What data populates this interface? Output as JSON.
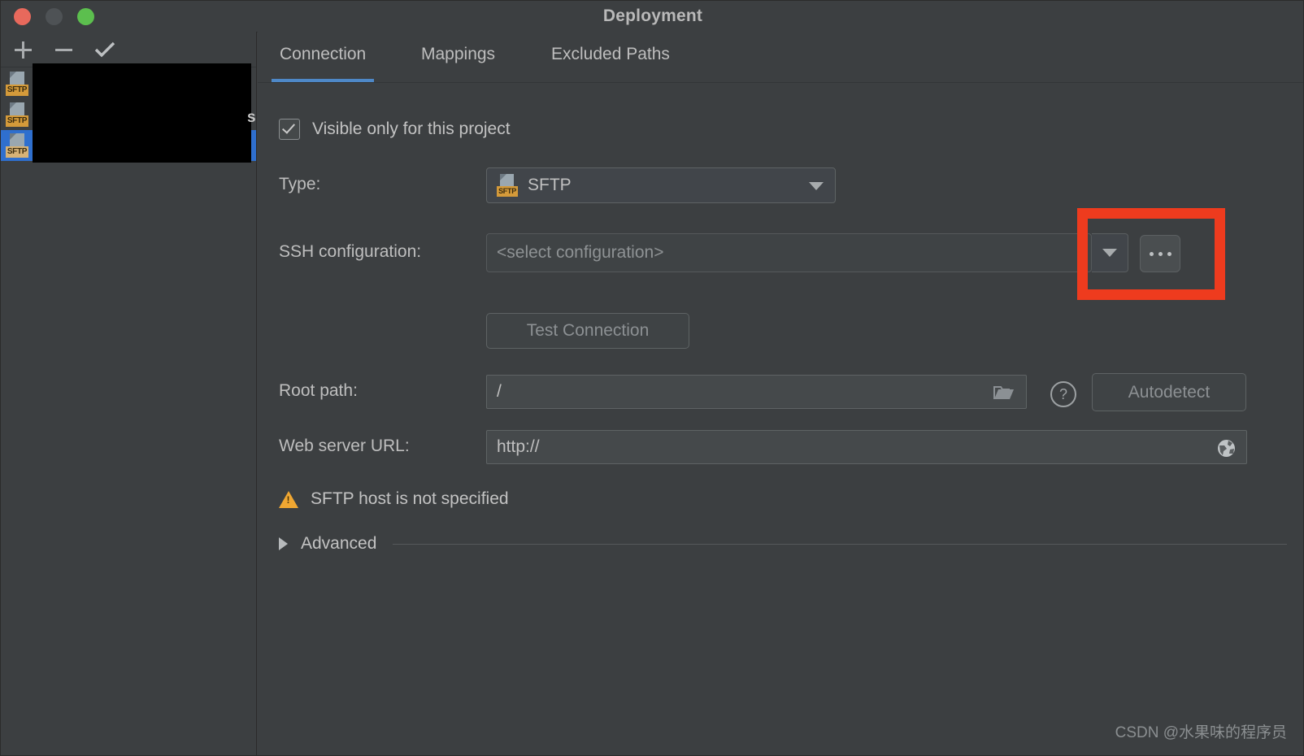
{
  "window": {
    "title": "Deployment",
    "traffic_lights": [
      "close-button",
      "minimize-button",
      "maximize-button"
    ]
  },
  "sidebar": {
    "toolbar": {
      "add_label": "+",
      "remove_label": "−",
      "confirm_label": "✓"
    },
    "items": [
      {
        "label": "",
        "type": "SFTP",
        "selected": false
      },
      {
        "label": "",
        "type": "SFTP",
        "selected": false
      },
      {
        "label": "",
        "type": "SFTP",
        "selected": true
      }
    ],
    "redacted_partial_text": "s"
  },
  "tabs": [
    {
      "label": "Connection",
      "active": true
    },
    {
      "label": "Mappings",
      "active": false
    },
    {
      "label": "Excluded Paths",
      "active": false
    }
  ],
  "connection": {
    "visible_only_checkbox": {
      "label": "Visible only for this project",
      "checked": true
    },
    "type": {
      "label": "Type:",
      "value": "SFTP",
      "icon": "sftp-icon"
    },
    "ssh_configuration": {
      "label": "SSH configuration:",
      "value": "",
      "placeholder": "<select configuration>",
      "browse_label": "…"
    },
    "test_connection": {
      "label": "Test Connection"
    },
    "root_path": {
      "label": "Root path:",
      "value": "/",
      "help_label": "?",
      "autodetect_label": "Autodetect"
    },
    "web_server_url": {
      "label": "Web server URL:",
      "value": "http://"
    },
    "warning": {
      "text": "SFTP host is not specified"
    },
    "advanced": {
      "label": "Advanced",
      "expanded": false
    }
  },
  "annotation": {
    "highlight_color": "#EE3B1E",
    "target": "ssh-configuration-browse-controls"
  },
  "watermark": {
    "text": "CSDN @水果味的程序员"
  }
}
